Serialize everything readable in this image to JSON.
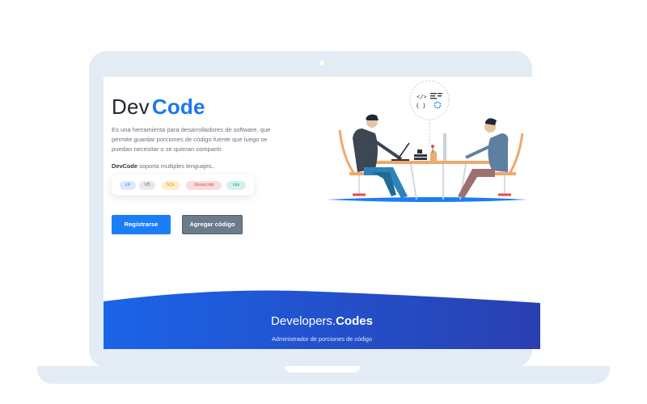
{
  "hero": {
    "brand_light": "Dev",
    "brand_bold": "Code",
    "description": "Es una herramienta para desarrolladores de software, que permite guardar porciones de código fuente que luego se puedan necesitar o se quieran compartir.",
    "support_bold": "DevCode",
    "support_text": " soporta multiples lenguajes.."
  },
  "languages": [
    {
      "label": "c#",
      "bg": "#dbe8fb",
      "fg": "#3b6fcf"
    },
    {
      "label": "VB",
      "bg": "#e7e9ec",
      "fg": "#6b7280"
    },
    {
      "label": "SQL",
      "bg": "#fcefc8",
      "fg": "#d39a12"
    },
    {
      "label": "Javascript",
      "bg": "#fbdcdc",
      "fg": "#d84a4a"
    },
    {
      "label": "css",
      "bg": "#d2f2ec",
      "fg": "#1b8c78"
    }
  ],
  "actions": {
    "register_label": "Registrarse",
    "add_code_label": "Agregar código"
  },
  "footer": {
    "title_light": "Developers.",
    "title_bold": "Codes",
    "subtitle": "Administrador de porciones de código"
  },
  "colors": {
    "accent": "#1a78f2",
    "button_primary": "#1b7ef6",
    "button_secondary": "#6b7b8a",
    "footer_gradient_start": "#1b64e8",
    "footer_gradient_end": "#2a3fb0"
  }
}
